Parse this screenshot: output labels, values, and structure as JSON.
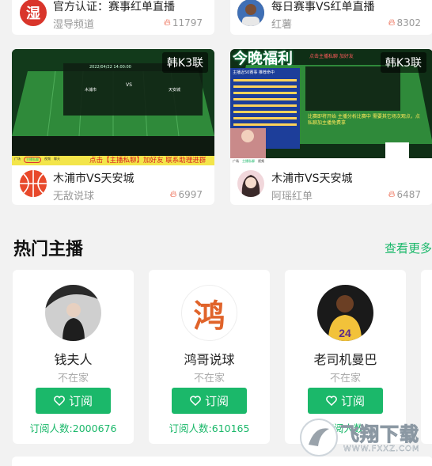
{
  "top_row": [
    {
      "title": "官方认证：赛事红单直播",
      "source": "湿导频道",
      "heat": "11797",
      "avatar_char": "湿"
    },
    {
      "title": "每日赛事VS红单直播",
      "source": "红薯",
      "heat": "8302"
    }
  ],
  "streams": [
    {
      "badge": "韩K3联",
      "title": "木浦市VS天安城",
      "source": "无敌说球",
      "heat": "6997",
      "thumb": {
        "header": "2022/04/22 14:00:00",
        "home": "木浦市",
        "away": "天安城",
        "vs": "VS",
        "banner": "点击【主播私聊】加好友 联系助理进群",
        "tab_1": "广场",
        "tab_2": "主播私聊",
        "tab_3": "视频",
        "tab_4": "聊天"
      }
    },
    {
      "badge": "韩K3联",
      "title": "木浦市VS天安城",
      "source": "阿瑶红单",
      "heat": "6487",
      "thumb": {
        "promo": "今晚福利",
        "top_text": "点击主播私聊 加好友",
        "notice": "比赛即将开始 主播分析比赛中 需要其它场次观点，点私聊加主播免费拿",
        "side_title": "主播近50赛事 推荐命中",
        "tab_1": "广场",
        "tab_2": "主播私聊",
        "tab_3": "视频"
      }
    }
  ],
  "section": {
    "title": "热门主播",
    "more": "查看更多"
  },
  "hosts": [
    {
      "name": "钱夫人",
      "status": "不在家",
      "button": "订阅",
      "subs": "订阅人数:2000676"
    },
    {
      "name": "鸿哥说球",
      "status": "不在家",
      "button": "订阅",
      "subs": "订阅人数:610165",
      "avatar_char": "鸿"
    },
    {
      "name": "老司机曼巴",
      "status": "不在家",
      "button": "订阅",
      "subs": "订阅人数:",
      "jersey": "24"
    }
  ],
  "watermark": {
    "text": "飞翔下载",
    "url": "WWW.FXXZ.COM"
  },
  "colors": {
    "accent": "#1bb86a",
    "heat": "#e8492b",
    "pitch": "#2f8a3a"
  }
}
